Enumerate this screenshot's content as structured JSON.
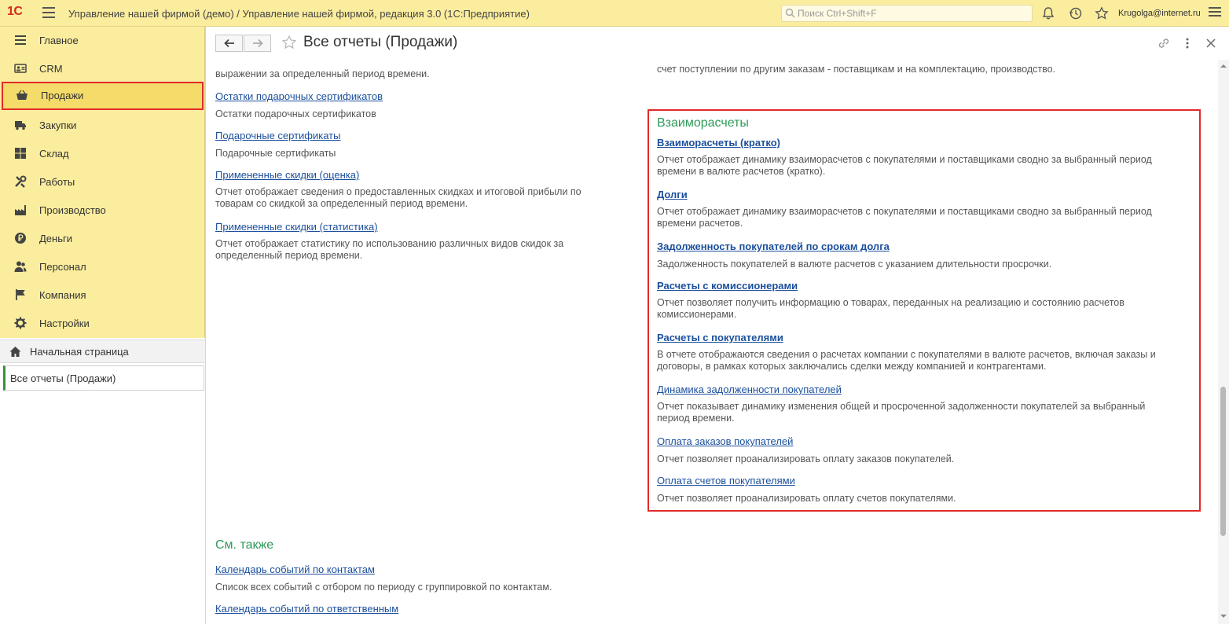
{
  "topbar": {
    "logo": "1С",
    "title": "Управление нашей фирмой (демо) / Управление нашей фирмой, редакция 3.0  (1С:Предприятие)",
    "search_placeholder": "Поиск Ctrl+Shift+F",
    "user": "Krugolga@internet.ru"
  },
  "sidebar": {
    "sections": [
      {
        "label": "Главное",
        "icon": "menu-lines-icon"
      },
      {
        "label": "CRM",
        "icon": "contact-card-icon"
      },
      {
        "label": "Продажи",
        "icon": "basket-icon",
        "active": true
      },
      {
        "label": "Закупки",
        "icon": "truck-icon"
      },
      {
        "label": "Склад",
        "icon": "boxes-icon"
      },
      {
        "label": "Работы",
        "icon": "tools-icon"
      },
      {
        "label": "Производство",
        "icon": "factory-icon"
      },
      {
        "label": "Деньги",
        "icon": "ruble-coin-icon"
      },
      {
        "label": "Персонал",
        "icon": "people-icon"
      },
      {
        "label": "Компания",
        "icon": "flag-icon"
      },
      {
        "label": "Настройки",
        "icon": "gear-icon"
      }
    ],
    "home": "Начальная страница",
    "open_window": "Все отчеты (Продажи)"
  },
  "header": {
    "title": "Все отчеты (Продажи)"
  },
  "left_column": {
    "top_fragment": "выражении за определенный период времени.",
    "items": [
      {
        "link": "Остатки подарочных сертификатов",
        "desc": [
          "Остатки подарочных сертификатов"
        ]
      },
      {
        "link": "Подарочные сертификаты",
        "desc": [
          "Подарочные сертификаты"
        ]
      },
      {
        "link": "Примененные скидки (оценка)",
        "desc": [
          "Отчет отображает сведения о предоставленных скидках и итоговой прибыли по",
          "товарам со скидкой за определенный период времени."
        ]
      },
      {
        "link": "Примененные скидки (статистика)",
        "desc": [
          "Отчет отображает статистику по использованию различных видов скидок за",
          "определенный период времени."
        ]
      }
    ]
  },
  "right_column": {
    "top_fragment": "счет поступлении по другим заказам - поставщикам и на комплектацию, производство.",
    "group_title": "Взаиморасчеты",
    "items": [
      {
        "link": "Взаиморасчеты (кратко)",
        "desc": [
          "Отчет отображает динамику взаиморасчетов с покупателями и поставщиками сводно за выбранный период",
          "времени в валюте расчетов (кратко)."
        ]
      },
      {
        "link": "Долги",
        "desc": [
          "Отчет отображает динамику взаиморасчетов с покупателями и поставщиками сводно за выбранный период",
          "времени расчетов."
        ]
      },
      {
        "link": "Задолженность покупателей по срокам долга",
        "desc": [
          "Задолженность покупателей в валюте расчетов с указанием длительности просрочки."
        ]
      },
      {
        "link": "Расчеты с комиссионерами",
        "desc": [
          "Отчет позволяет получить информацию о товарах, переданных на реализацию и состоянию расчетов",
          "комиссионерами."
        ]
      },
      {
        "link": "Расчеты с покупателями",
        "desc": [
          "В отчете отображаются сведения о расчетах компании с покупателями в валюте расчетов, включая заказы и",
          "договоры, в рамках которых заключались сделки между компанией и контрагентами."
        ]
      },
      {
        "link": "Динамика задолженности покупателей",
        "desc": [
          "Отчет показывает динамику изменения общей и просроченной задолженности покупателей за выбранный",
          "период времени."
        ]
      },
      {
        "link": "Оплата заказов покупателей",
        "desc": [
          "Отчет позволяет проанализировать оплату заказов покупателей."
        ]
      },
      {
        "link": "Оплата счетов покупателями",
        "desc": [
          "Отчет позволяет проанализировать оплату счетов покупателями."
        ]
      }
    ]
  },
  "see_also": {
    "title": "См. также",
    "items": [
      {
        "link": "Календарь событий по контактам",
        "desc": "Список всех событий с отбором по периоду с группировкой по контактам."
      },
      {
        "link": "Календарь событий по ответственным"
      }
    ]
  },
  "colors": {
    "section_bg": "#fbed9e",
    "link": "#1b4f9c",
    "group_title": "#2f9a5a",
    "highlight": "#e22a2a"
  }
}
